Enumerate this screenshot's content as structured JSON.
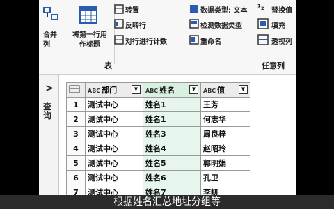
{
  "ribbon": {
    "merge_columns_label": "合并列",
    "first_row_as_header_label": "将第一行用作标题",
    "transpose_label": "转置",
    "reverse_rows_label": "反转行",
    "count_rows_label": "对行进行计数",
    "data_type_label": "数据类型: 文本",
    "detect_data_type_label": "检测数据类型",
    "rename_label": "重命名",
    "replace_values_label": "替换值",
    "fill_label": "填充",
    "pivot_column_label": "透视列",
    "table_section_label": "表",
    "any_column_section_label": "任意列"
  },
  "queries_pane": {
    "label": "查询"
  },
  "table": {
    "columns": [
      "部门",
      "姓名",
      "值"
    ],
    "rows": [
      {
        "idx": "1",
        "dept": "测试中心",
        "name": "姓名1",
        "val": "王芳"
      },
      {
        "idx": "2",
        "dept": "测试中心",
        "name": "姓名1",
        "val": "何志华"
      },
      {
        "idx": "3",
        "dept": "测试中心",
        "name": "姓名3",
        "val": "周良梓"
      },
      {
        "idx": "4",
        "dept": "测试中心",
        "name": "姓名4",
        "val": "赵昭玲"
      },
      {
        "idx": "5",
        "dept": "测试中心",
        "name": "姓名5",
        "val": "郭明娟"
      },
      {
        "idx": "6",
        "dept": "测试中心",
        "name": "姓名6",
        "val": "孔卫"
      },
      {
        "idx": "7",
        "dept": "测试中心",
        "name": "姓名7",
        "val": "李岍"
      }
    ]
  },
  "caption": "根据姓名汇总地址分组等"
}
